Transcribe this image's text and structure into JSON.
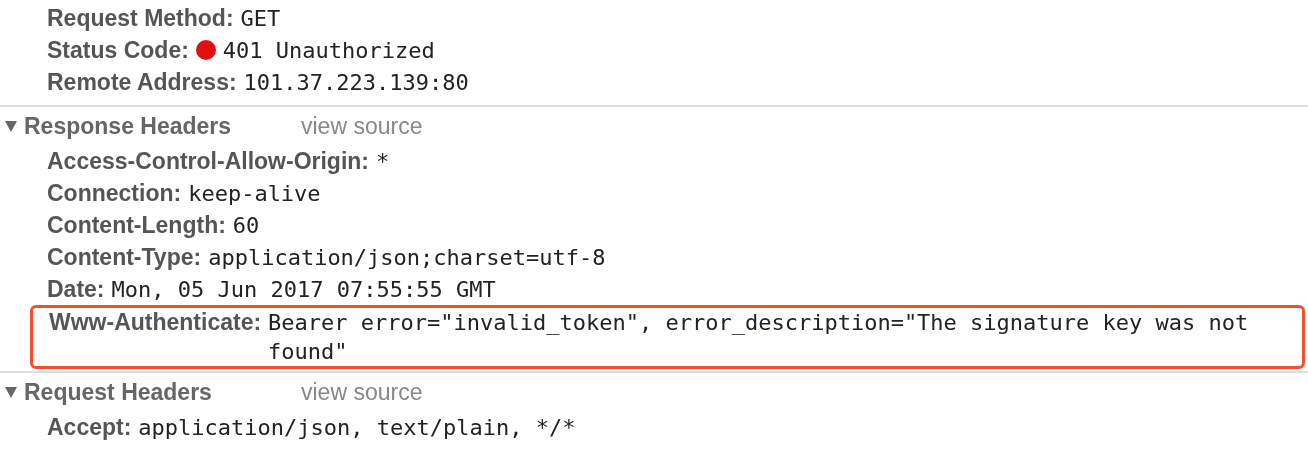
{
  "general": [
    {
      "name": "Request Method:",
      "value": "GET"
    },
    {
      "name": "Status Code:",
      "value": "401 Unauthorized",
      "color": "#e0100f"
    },
    {
      "name": "Remote Address:",
      "value": "101.37.223.139:80"
    }
  ],
  "sections": [
    {
      "title": "Response Headers",
      "expanded": true,
      "link": "view source",
      "headers": [
        {
          "name": "Access-Control-Allow-Origin:",
          "value": "*",
          "highlighted": false
        },
        {
          "name": "Connection:",
          "value": "keep-alive",
          "highlighted": false
        },
        {
          "name": "Content-Length:",
          "value": "60",
          "highlighted": false
        },
        {
          "name": "Content-Type:",
          "value": "application/json;charset=utf-8",
          "highlighted": false
        },
        {
          "name": "Date:",
          "value": "Mon, 05 Jun 2017 07:55:55 GMT",
          "highlighted": false
        },
        {
          "name": "Www-Authenticate:",
          "value": "Bearer error=\"invalid_token\", error_description=\"The signature key was not found\"",
          "highlighted": true
        }
      ]
    },
    {
      "title": "Request Headers",
      "expanded": true,
      "link": "view source",
      "headers": [
        {
          "name": "Accept:",
          "value": "application/json, text/plain, */*",
          "highlighted": false
        }
      ]
    }
  ]
}
